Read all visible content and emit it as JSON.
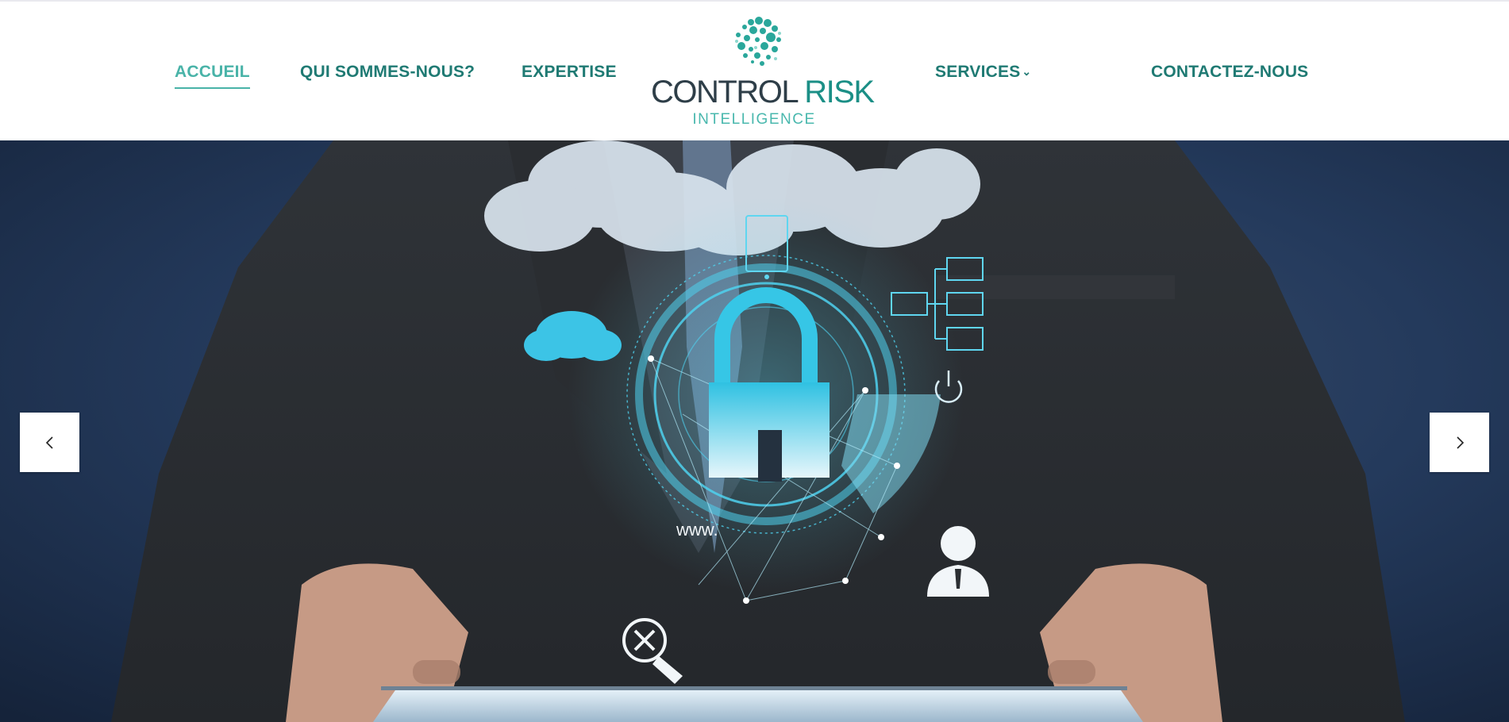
{
  "nav": {
    "items": [
      {
        "label": "ACCUEIL",
        "active": true
      },
      {
        "label": "QUI SOMMES-NOUS?"
      },
      {
        "label": "EXPERTISE"
      },
      {
        "label": "SERVICES",
        "has_dropdown": true,
        "icon": "chevron-down-icon"
      },
      {
        "label": "CONTACTEZ-NOUS"
      }
    ]
  },
  "logo": {
    "title_part1": "CONTROL",
    "title_part2": "RISK",
    "subtitle": "INTELLIGENCE",
    "icon": "globe-dots-icon"
  },
  "hero": {
    "overlay_text": "www.",
    "icons": [
      "cloud-icon",
      "padlock-icon",
      "tablet-icon",
      "network-icon",
      "power-icon",
      "user-icon",
      "search-close-icon"
    ]
  },
  "slider": {
    "prev_icon": "chevron-left-icon",
    "next_icon": "chevron-right-icon"
  },
  "colors": {
    "nav_text": "#1f7a73",
    "nav_active": "#49b3a8",
    "logo_dark": "#2e3e48",
    "logo_accent": "#1b8f86",
    "hero_background": "#24385a",
    "hologram": "#3fc8e6"
  }
}
